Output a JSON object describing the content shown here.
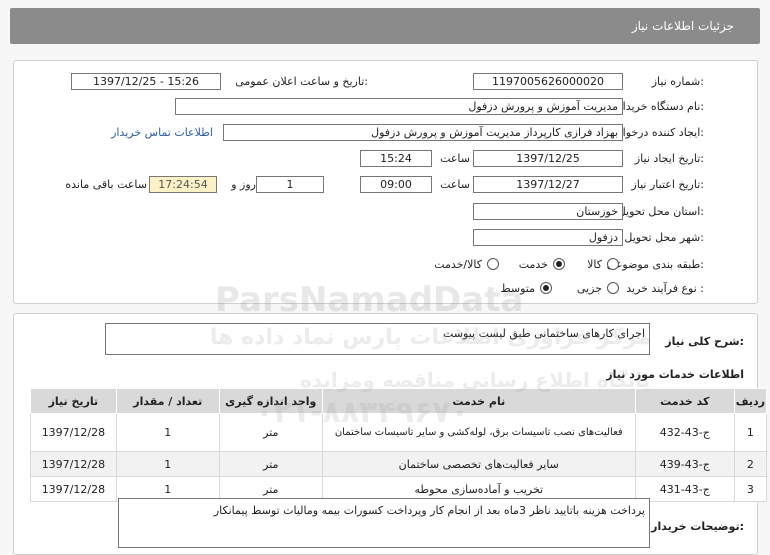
{
  "header": {
    "title": "جزئیات اطلاعات نیاز"
  },
  "form": {
    "need_number_label": "شماره نیاز:",
    "need_number": "1197005626000020",
    "announce_label": "تاریخ و ساعت اعلان عمومی:",
    "announce_value": "1397/12/25 - 15:26",
    "buyer_org_label": "نام دستگاه خریدار:",
    "buyer_org": "مدیریت آموزش و پرورش دزفول",
    "requester_label": "ایجاد کننده درخواست:",
    "requester": "بهزاد فرازی کارپرداز مدیریت آموزش و پرورش دزفول",
    "contact_link": "اطلاعات تماس خریدار",
    "created_label": "تاریخ ایجاد نیاز:",
    "created_date": "1397/12/25",
    "time_label": "ساعت",
    "created_time": "15:24",
    "validity_label": "تاریخ اعتبار نیاز:",
    "validity_date": "1397/12/27",
    "validity_time": "09:00",
    "days_value": "1",
    "days_label": "روز و",
    "remaining_time": "17:24:54",
    "remaining_label": "ساعت باقی مانده",
    "province_label": "استان محل تحویل:",
    "province": "خوزستان",
    "city_label": "شهر محل تحویل:",
    "city": "دزفول",
    "category_label": "طبقه بندی موضوعی:",
    "category_options": [
      "کالا",
      "خدمت",
      "کالا/خدمت"
    ],
    "category_selected": "خدمت",
    "process_label": "نوع فرآیند خرید :",
    "process_options": [
      "جزیی",
      "متوسط"
    ],
    "process_selected": "متوسط"
  },
  "summary": {
    "label": "شرح کلی نیاز:",
    "value": "اجرای کارهای ساختمانی طبق لیست پیوست"
  },
  "services": {
    "title": "اطلاعات خدمات مورد نیاز",
    "columns": [
      "ردیف",
      "کد خدمت",
      "نام خدمت",
      "واحد اندازه گیری",
      "تعداد / مقدار",
      "تاریخ نیاز"
    ],
    "rows": [
      {
        "index": "1",
        "code": "ج-43-432",
        "name": "فعالیت‌های نصب تاسیسات برق، لوله‌کشی و سایر تاسیسات ساختمان",
        "unit": "متر",
        "qty": "1",
        "date": "1397/12/28"
      },
      {
        "index": "2",
        "code": "ج-43-439",
        "name": "سایر فعالیت‌های تخصصی ساختمان",
        "unit": "متر",
        "qty": "1",
        "date": "1397/12/28"
      },
      {
        "index": "3",
        "code": "ج-43-431",
        "name": "تخریب و آماده‌سازی محوطه",
        "unit": "متر",
        "qty": "1",
        "date": "1397/12/28"
      }
    ]
  },
  "buyer_notes": {
    "label": "توضیحات خریدار:",
    "value": "پرداخت هزینه باتایید ناظر 3ماه بعد از انجام کار وپرداخت کسورات بیمه ومالیات توسط پیمانکار"
  },
  "watermark": {
    "brand": "ParsNamadData",
    "line1": "پایگاه اطلاع رسانی مناقصه ومزایده",
    "line2": "مرکز فراوری اطلاعات پارس نماد داده ها",
    "phone": "۰۲۱-۸۸۳۴۹۶۷۰"
  }
}
